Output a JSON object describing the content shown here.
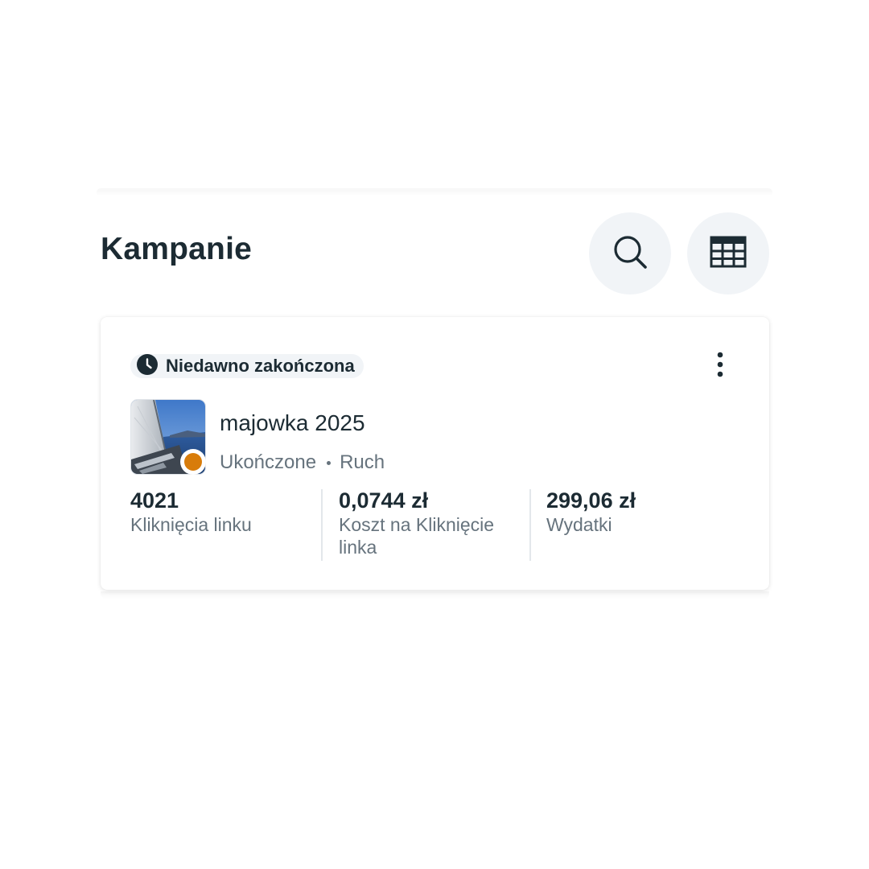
{
  "header": {
    "title": "Kampanie",
    "search_icon": "search-icon",
    "table_icon": "table-icon"
  },
  "campaign_card": {
    "badge": {
      "icon": "clock-icon",
      "label": "Niedawno zakończona"
    },
    "more_icon": "more-vertical-icon",
    "thumbnail": "sailboat-photo",
    "status_color": "#d87c0a",
    "name": "majowka 2025",
    "status": "Ukończone",
    "objective": "Ruch",
    "metrics": [
      {
        "value": "4021",
        "label": "Kliknięcia linku"
      },
      {
        "value": "0,0744 zł",
        "label": "Koszt na Kliknięcie linka"
      },
      {
        "value": "299,06 zł",
        "label": "Wydatki"
      }
    ]
  }
}
